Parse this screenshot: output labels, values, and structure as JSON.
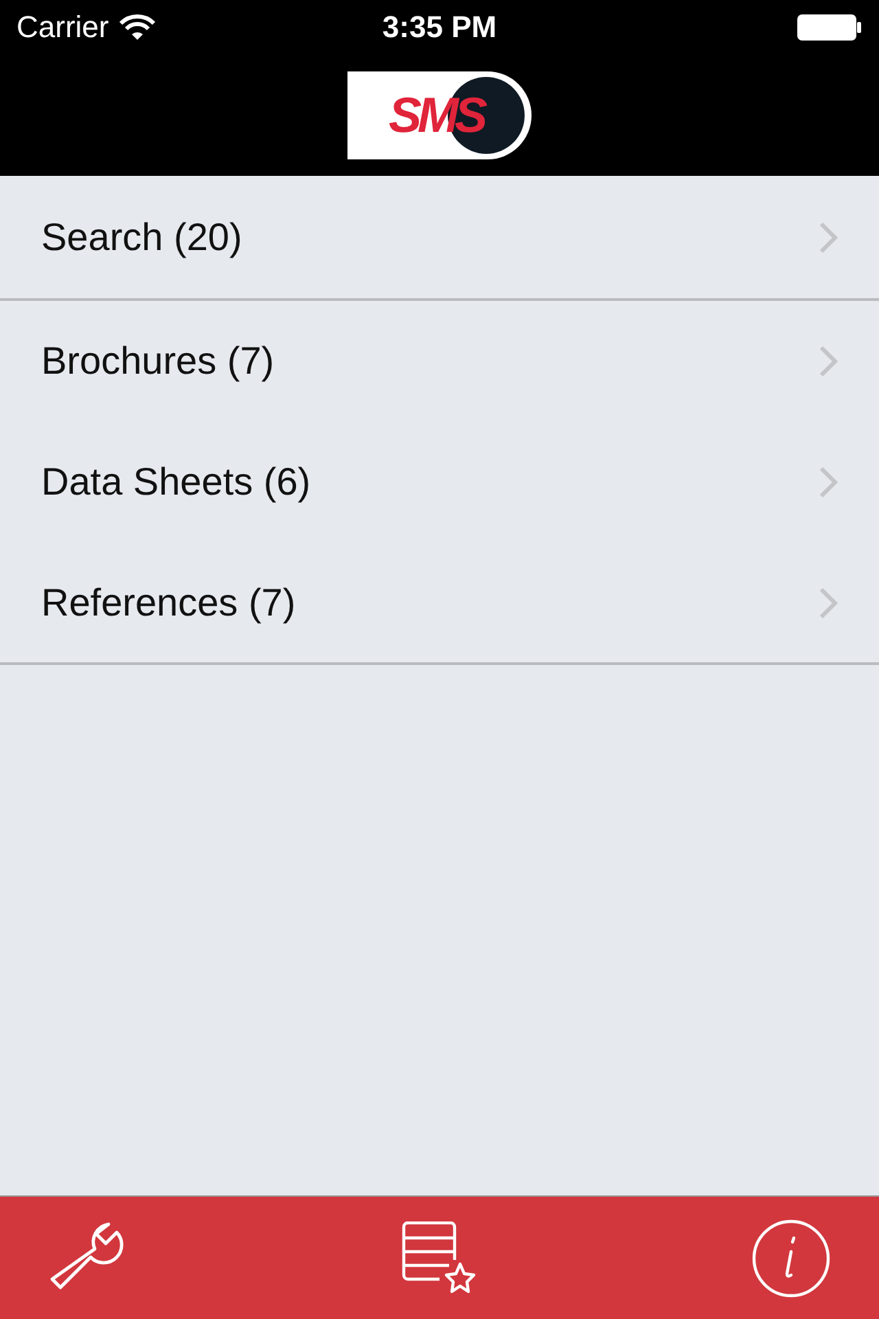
{
  "status_bar": {
    "carrier": "Carrier",
    "time": "3:35 PM"
  },
  "header": {
    "logo": "SMS"
  },
  "menu": [
    {
      "label": "Search (20)",
      "group_end": true
    },
    {
      "label": "Brochures (7)",
      "group_end": false
    },
    {
      "label": "Data Sheets (6)",
      "group_end": false
    },
    {
      "label": "References (7)",
      "group_end": true
    }
  ],
  "tab_bar": [
    {
      "kind": "tools"
    },
    {
      "kind": "favorites"
    },
    {
      "kind": "info"
    }
  ]
}
